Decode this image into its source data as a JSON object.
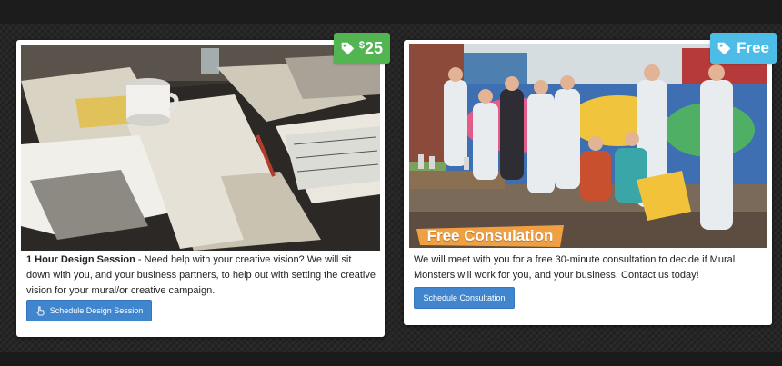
{
  "cards": [
    {
      "price_badge": {
        "currency": "$",
        "amount": "25",
        "color": "#52b551",
        "icon": "tag-icon"
      },
      "photo": {
        "subject": "design session desk with sketches and coffee mug"
      },
      "title": "1 Hour Design Session",
      "description": " - Need help with your creative vision? We will sit down with you, and your business partners, to help out with setting the creative vision for your mural/or creative campaign.",
      "button": {
        "label": "Schedule Design Session",
        "icon": "hand-pointer-icon",
        "color": "#3f86cf"
      }
    },
    {
      "price_badge": {
        "text": "Free",
        "color": "#4dbde8",
        "icon": "tag-icon"
      },
      "photo": {
        "subject": "group of artists in white coveralls in front of graffiti",
        "overlay_label": "Free Consulation",
        "overlay_color": "#f0a043"
      },
      "description": "We will meet with you for a free 30-minute consultation to decide if Mural Monsters will work for you, and your business. Contact us today!",
      "button": {
        "label": "Schedule Consultation",
        "color": "#3f86cf"
      }
    }
  ]
}
